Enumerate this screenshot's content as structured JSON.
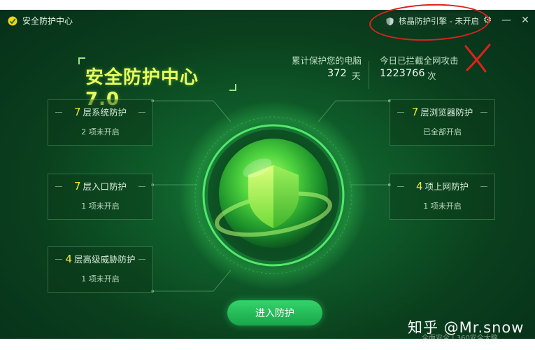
{
  "window": {
    "app_title": "安全防护中心",
    "engine_button": "核晶防护引擎 - 未开启"
  },
  "brand": {
    "title": "安全防护中心 7.0"
  },
  "stats": {
    "protected_label": "累计保护您的电脑",
    "protected_value": "372",
    "protected_unit": "天",
    "blocked_label": "今日已拦截全网攻击",
    "blocked_value": "1223766",
    "blocked_unit": "次"
  },
  "cards": [
    {
      "num": "7",
      "title": "层系统防护",
      "status": "2 项未开启"
    },
    {
      "num": "7",
      "title": "层入口防护",
      "status": "1 项未开启"
    },
    {
      "num": "4",
      "title": "层高级威胁防护",
      "status": "1 项未开启"
    },
    {
      "num": "7",
      "title": "层浏览器防护",
      "status": "已全部开启"
    },
    {
      "num": "4",
      "title": "项上网防护",
      "status": "1 项未开启"
    }
  ],
  "actions": {
    "enter_label": "进入防护"
  },
  "watermark": {
    "text": "知乎 @Mr.snow",
    "sub": "全面安全 | 360安全大脑"
  },
  "colors": {
    "accent_yellow": "#f2e838",
    "brand_yellow": "#e7ff5c",
    "button_green": "#24bd58",
    "annotation_red": "#e0201c"
  },
  "icons": [
    "app-logo-icon",
    "engine-shield-icon",
    "gear-icon",
    "minimize-icon",
    "close-icon",
    "shield-icon"
  ]
}
